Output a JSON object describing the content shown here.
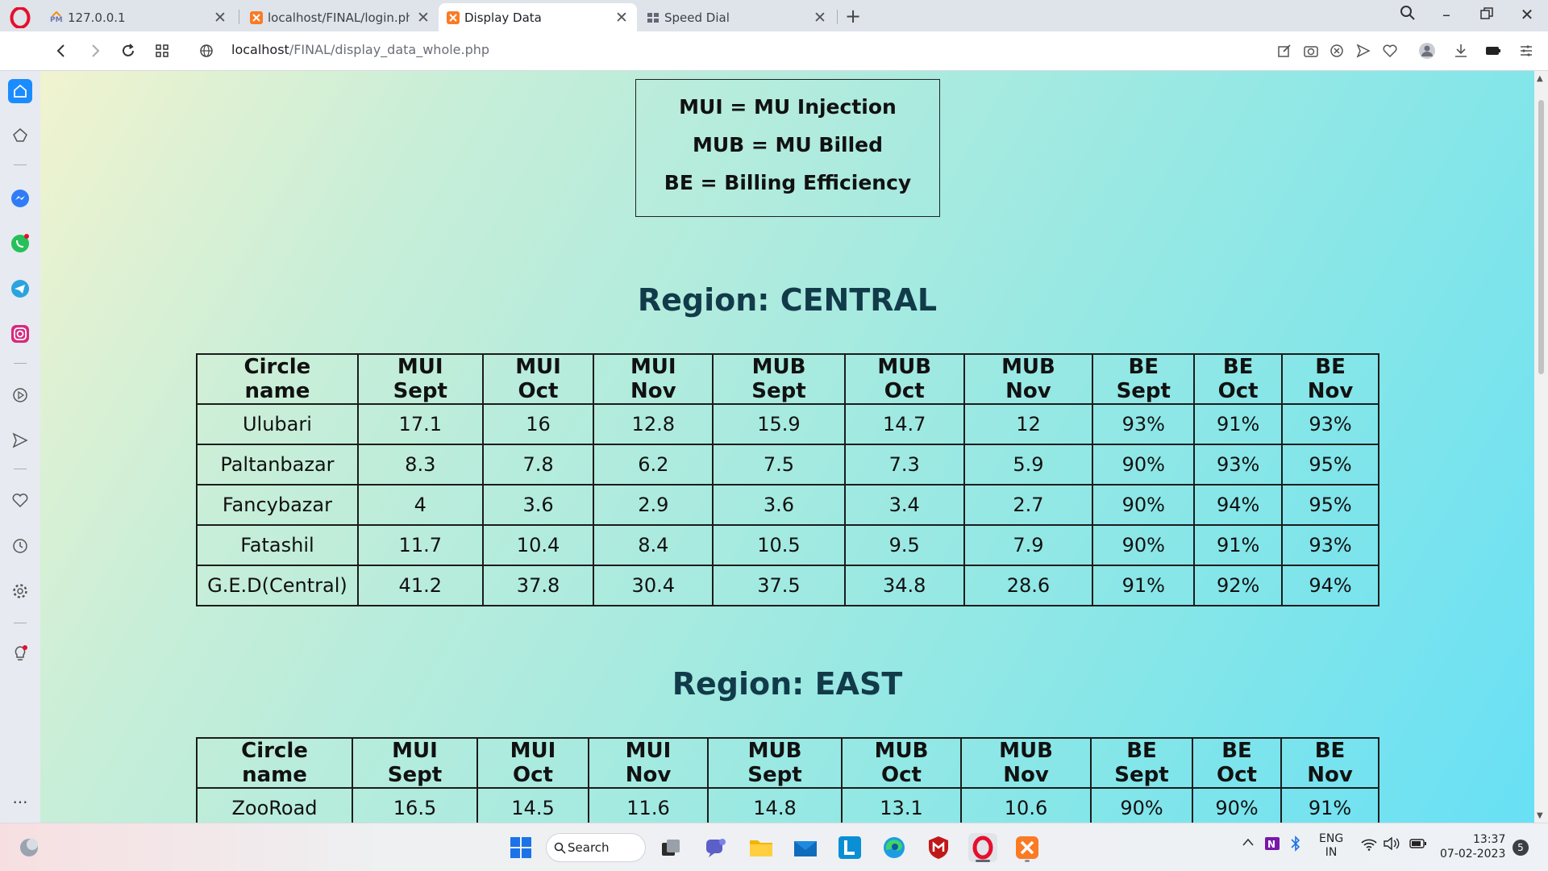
{
  "browser": {
    "tabs": [
      {
        "label": "127.0.0.1",
        "active": false,
        "icon": "phpmyadmin-icon"
      },
      {
        "label": "localhost/FINAL/login.php",
        "active": false,
        "icon": "xampp-icon"
      },
      {
        "label": "Display Data",
        "active": true,
        "icon": "xampp-icon"
      },
      {
        "label": "Speed Dial",
        "active": false,
        "icon": "speed-dial-icon"
      }
    ],
    "url_host": "localhost",
    "url_path": "/FINAL/display_data_whole.php"
  },
  "legend": {
    "line1": "MUI = MU Injection",
    "line2": "MUB = MU Billed",
    "line3": "BE = Billing Efficiency"
  },
  "columns": [
    "Circle name",
    "MUI Sept",
    "MUI Oct",
    "MUI Nov",
    "MUB Sept",
    "MUB Oct",
    "MUB Nov",
    "BE Sept",
    "BE Oct",
    "BE Nov"
  ],
  "regions": [
    {
      "title": "Region: CENTRAL",
      "rows": [
        [
          "Ulubari",
          "17.1",
          "16",
          "12.8",
          "15.9",
          "14.7",
          "12",
          "93%",
          "91%",
          "93%"
        ],
        [
          "Paltanbazar",
          "8.3",
          "7.8",
          "6.2",
          "7.5",
          "7.3",
          "5.9",
          "90%",
          "93%",
          "95%"
        ],
        [
          "Fancybazar",
          "4",
          "3.6",
          "2.9",
          "3.6",
          "3.4",
          "2.7",
          "90%",
          "94%",
          "95%"
        ],
        [
          "Fatashil",
          "11.7",
          "10.4",
          "8.4",
          "10.5",
          "9.5",
          "7.9",
          "90%",
          "91%",
          "93%"
        ],
        [
          "G.E.D(Central)",
          "41.2",
          "37.8",
          "30.4",
          "37.5",
          "34.8",
          "28.6",
          "91%",
          "92%",
          "94%"
        ]
      ]
    },
    {
      "title": "Region: EAST",
      "rows": [
        [
          "ZooRoad",
          "16.5",
          "14.5",
          "11.6",
          "14.8",
          "13.1",
          "10.6",
          "90%",
          "90%",
          "91%"
        ]
      ]
    }
  ],
  "taskbar": {
    "search_label": "Search",
    "lang_line1": "ENG",
    "lang_line2": "IN",
    "time": "13:37",
    "date": "07-02-2023",
    "notification_count": "5"
  },
  "colors": {
    "region_title": "#123b4a",
    "opera_red": "#e5102d",
    "sidebar_active": "#1a8cff"
  }
}
